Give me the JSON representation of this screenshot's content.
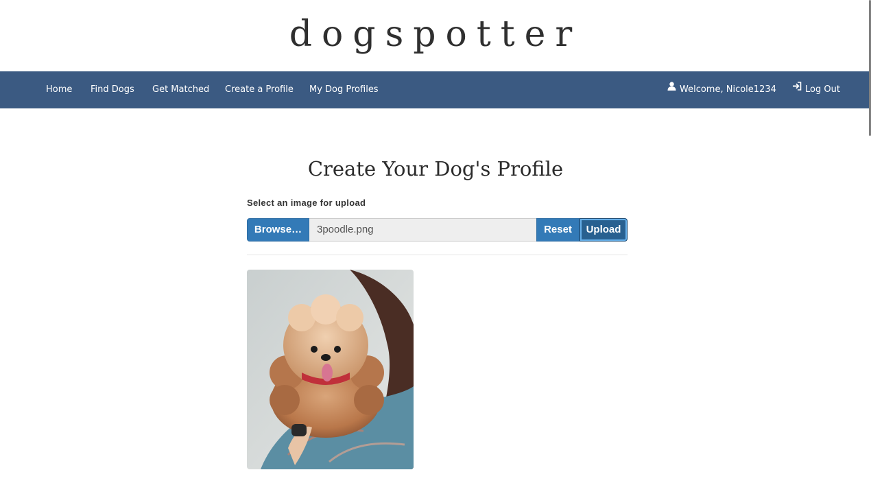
{
  "brand": {
    "title": "dogspotter"
  },
  "nav": {
    "items": [
      {
        "label": "Home"
      },
      {
        "label": "Find Dogs"
      },
      {
        "label": "Get Matched"
      },
      {
        "label": "Create a Profile"
      },
      {
        "label": "My Dog Profiles"
      }
    ],
    "welcome": {
      "label": "Welcome, Nicole1234",
      "icon": "user-icon"
    },
    "logout": {
      "label": "Log Out",
      "icon": "log-in-icon"
    },
    "background_color": "#3b5a82"
  },
  "page": {
    "title": "Create Your Dog's Profile"
  },
  "upload": {
    "label": "Select an image for upload",
    "browse_label": "Browse…",
    "file_name": "3poodle.png",
    "reset_label": "Reset",
    "upload_label": "Upload",
    "button_color": "#337ab7"
  },
  "preview": {
    "subject": "toy poodle held over a shoulder"
  }
}
